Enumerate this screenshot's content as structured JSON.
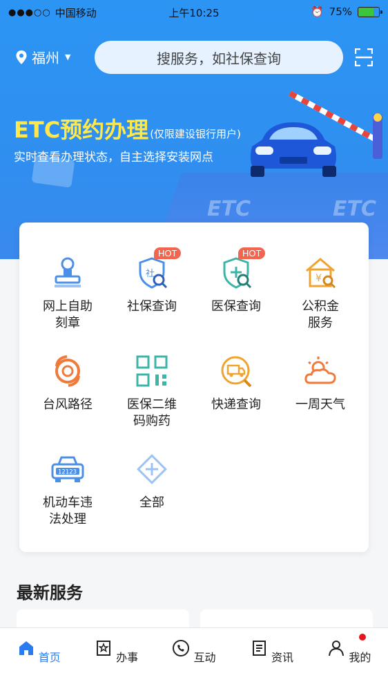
{
  "status_bar": {
    "signal": "●●●○○",
    "carrier": "中国移动",
    "time": "上午10:25",
    "battery": "75%",
    "battery_level": 0.75
  },
  "header": {
    "city": "福州",
    "search_placeholder": "搜服务，如社保查询"
  },
  "banner": {
    "title": "ETC预约办理",
    "subtitle": "(仅限建设银行用户)",
    "description": "实时查看办理状态，自主选择安装网点",
    "road_mark": "ETC"
  },
  "services": [
    {
      "label_1": "网上自助",
      "label_2": "刻章",
      "icon": "stamp-icon",
      "hot": false
    },
    {
      "label_1": "社保查询",
      "label_2": "",
      "icon": "social-security-search-icon",
      "hot": true
    },
    {
      "label_1": "医保查询",
      "label_2": "",
      "icon": "medical-insurance-search-icon",
      "hot": true
    },
    {
      "label_1": "公积金",
      "label_2": "服务",
      "icon": "housing-fund-icon",
      "hot": false
    },
    {
      "label_1": "台风路径",
      "label_2": "",
      "icon": "typhoon-icon",
      "hot": false
    },
    {
      "label_1": "医保二维",
      "label_2": "码购药",
      "icon": "qr-code-icon",
      "hot": false
    },
    {
      "label_1": "快递查询",
      "label_2": "",
      "icon": "express-delivery-icon",
      "hot": false
    },
    {
      "label_1": "一周天气",
      "label_2": "",
      "icon": "weather-icon",
      "hot": false
    },
    {
      "label_1": "机动车违",
      "label_2": "法处理",
      "icon": "traffic-violation-icon",
      "hot": false
    },
    {
      "label_1": "全部",
      "label_2": "",
      "icon": "all-services-icon",
      "hot": false
    }
  ],
  "hot_label": "HOT",
  "latest_section": {
    "title": "最新服务"
  },
  "tabs": [
    {
      "label": "首页",
      "icon": "home-icon",
      "active": true
    },
    {
      "label": "办事",
      "icon": "task-icon",
      "active": false
    },
    {
      "label": "互动",
      "icon": "phone-icon",
      "active": false
    },
    {
      "label": "资讯",
      "icon": "news-icon",
      "active": false
    },
    {
      "label": "我的",
      "icon": "user-icon",
      "active": false
    }
  ],
  "colors": {
    "accent": "#2b7bf0",
    "hero": "#2c95f4",
    "hot": "#f2654f",
    "title_yellow": "#ffe84b"
  }
}
